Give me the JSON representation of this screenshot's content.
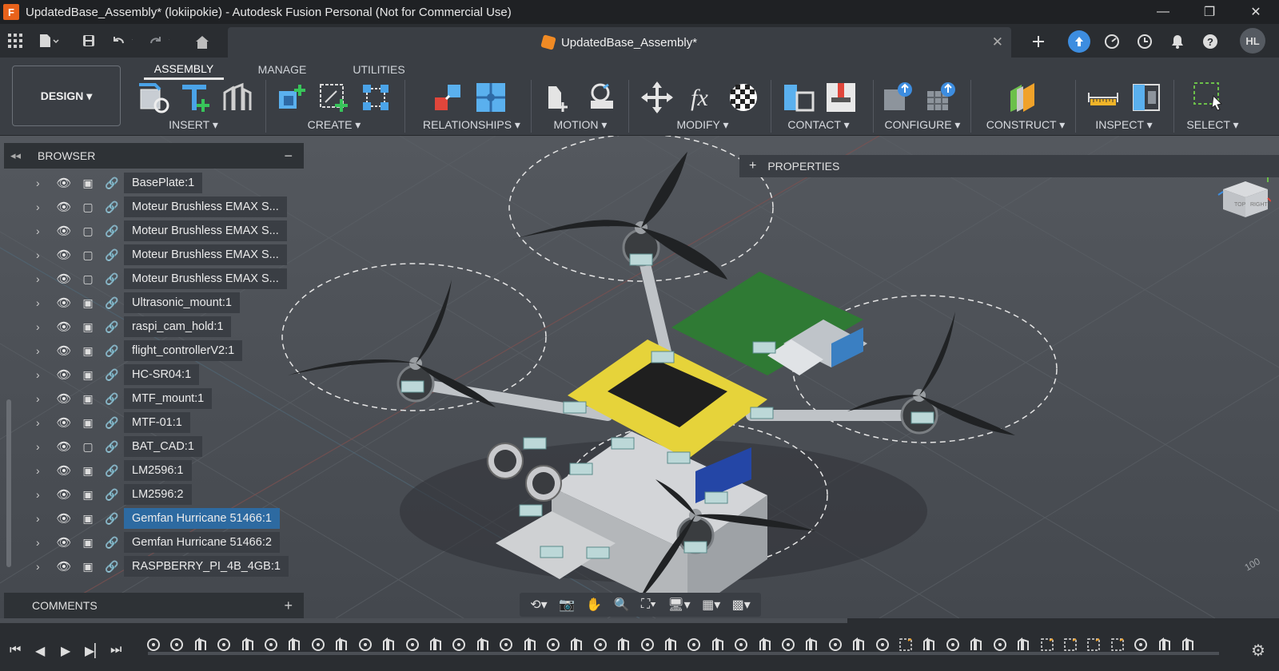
{
  "window": {
    "title": "UpdatedBase_Assembly* (lokiipokie) - Autodesk Fusion Personal (Not for Commercial Use)",
    "logo_letter": "F",
    "min": "—",
    "max": "❐",
    "close": "✕"
  },
  "document_tab": {
    "name": "UpdatedBase_Assembly*",
    "close": "✕"
  },
  "user": {
    "initials": "HL"
  },
  "workspace": {
    "label": "DESIGN ▾"
  },
  "ribbon_tabs": [
    {
      "label": "ASSEMBLY",
      "active": true
    },
    {
      "label": "MANAGE",
      "active": false
    },
    {
      "label": "UTILITIES",
      "active": false
    }
  ],
  "ribbon_groups": [
    {
      "label": "INSERT ▾"
    },
    {
      "label": "CREATE ▾"
    },
    {
      "label": "RELATIONSHIPS ▾"
    },
    {
      "label": "MOTION ▾"
    },
    {
      "label": "MODIFY ▾"
    },
    {
      "label": "CONTACT ▾"
    },
    {
      "label": "CONFIGURE ▾"
    },
    {
      "label": "CONSTRUCT ▾"
    },
    {
      "label": "INSPECT ▾"
    },
    {
      "label": "SELECT ▾"
    }
  ],
  "browser": {
    "title": "BROWSER",
    "items": [
      {
        "name": "BasePlate:1"
      },
      {
        "name": "Moteur Brushless EMAX S..."
      },
      {
        "name": "Moteur Brushless EMAX S..."
      },
      {
        "name": "Moteur Brushless EMAX S..."
      },
      {
        "name": "Moteur Brushless EMAX S..."
      },
      {
        "name": "Ultrasonic_mount:1"
      },
      {
        "name": "raspi_cam_hold:1"
      },
      {
        "name": "flight_controllerV2:1"
      },
      {
        "name": "HC-SR04:1"
      },
      {
        "name": "MTF_mount:1"
      },
      {
        "name": "MTF-01:1"
      },
      {
        "name": "BAT_CAD:1"
      },
      {
        "name": "LM2596:1"
      },
      {
        "name": "LM2596:2"
      },
      {
        "name": "Gemfan Hurricane 51466:1",
        "selected": true
      },
      {
        "name": "Gemfan Hurricane 51466:2"
      },
      {
        "name": "RASPBERRY_PI_4B_4GB:1"
      }
    ]
  },
  "properties": {
    "title": "PROPERTIES"
  },
  "comments": {
    "title": "COMMENTS"
  },
  "viewcube": {
    "top": "TOP",
    "right": "RIGHT"
  }
}
